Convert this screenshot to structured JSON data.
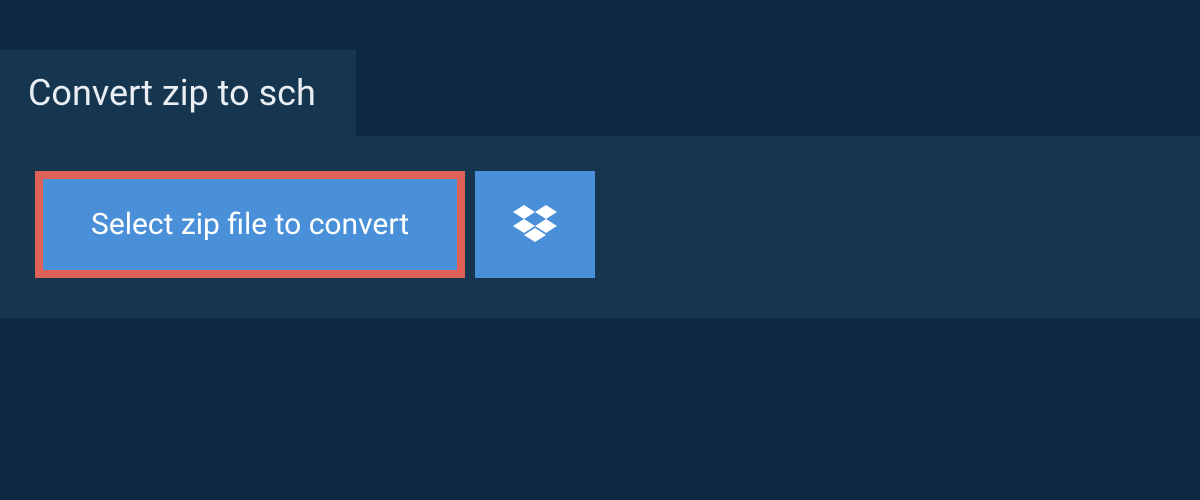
{
  "tab": {
    "title": "Convert zip to sch"
  },
  "actions": {
    "select_file_label": "Select zip file to convert"
  },
  "colors": {
    "background": "#0d2841",
    "panel": "#16354f",
    "button_primary": "#4a90d9",
    "button_highlight_border": "#e06157",
    "text_light": "#e8eef3"
  },
  "icons": {
    "dropbox": "dropbox-icon"
  }
}
